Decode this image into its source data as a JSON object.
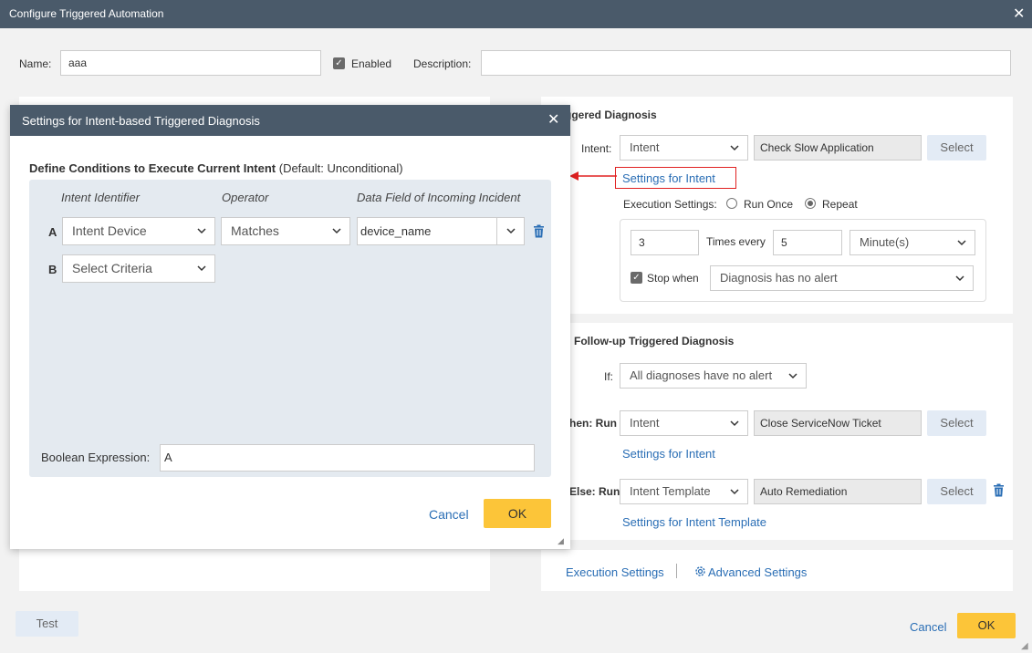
{
  "window": {
    "title": "Configure Triggered Automation",
    "name_label": "Name:",
    "name_value": "aaa",
    "enabled_label": "Enabled",
    "description_label": "Description:",
    "description_value": "",
    "test_button": "Test",
    "cancel_button": "Cancel",
    "ok_button": "OK"
  },
  "right": {
    "triggered_title": "ggered Diagnosis",
    "intent_label": "Intent:",
    "intent_type": "Intent",
    "intent_name": "Check Slow Application",
    "select_button": "Select",
    "settings_for_intent": "Settings for Intent",
    "execution_settings_label": "Execution Settings:",
    "run_once_label": "Run Once",
    "repeat_label": "Repeat",
    "times_value": "3",
    "times_every_label": "Times every",
    "every_value": "5",
    "unit_value": "Minute(s)",
    "stop_when_label": "Stop when",
    "stop_when_value": "Diagnosis has no alert",
    "followup_title": "Follow-up Triggered Diagnosis",
    "if_label": "If:",
    "if_value": "All diagnoses have no alert",
    "then_label": "hen: Run",
    "then_type": "Intent",
    "then_name": "Close ServiceNow Ticket",
    "then_select": "Select",
    "then_settings": "Settings for Intent",
    "else_label": "Else: Run",
    "else_type": "Intent Template",
    "else_name": "Auto Remediation",
    "else_select": "Select",
    "else_settings": "Settings for Intent Template",
    "execution_settings_tab": "Execution Settings",
    "advanced_settings_tab": "Advanced Settings"
  },
  "dialog": {
    "title": "Settings for Intent-based Triggered Diagnosis",
    "define_bold": "Define Conditions to Execute Current Intent",
    "define_default": " (Default: Unconditional)",
    "col_identifier": "Intent Identifier",
    "col_operator": "Operator",
    "col_field": "Data Field of Incoming Incident",
    "rows": [
      {
        "letter": "A",
        "identifier": "Intent Device",
        "operator": "Matches",
        "field": "device_name"
      },
      {
        "letter": "B",
        "identifier": "Select Criteria"
      }
    ],
    "boolean_label": "Boolean Expression:",
    "boolean_value": "A",
    "cancel_button": "Cancel",
    "ok_button": "OK"
  },
  "colors": {
    "title_bar": "#4a5a6a",
    "accent_ok": "#fcc539",
    "link": "#2a6eb5",
    "highlight_red": "#e02020"
  }
}
